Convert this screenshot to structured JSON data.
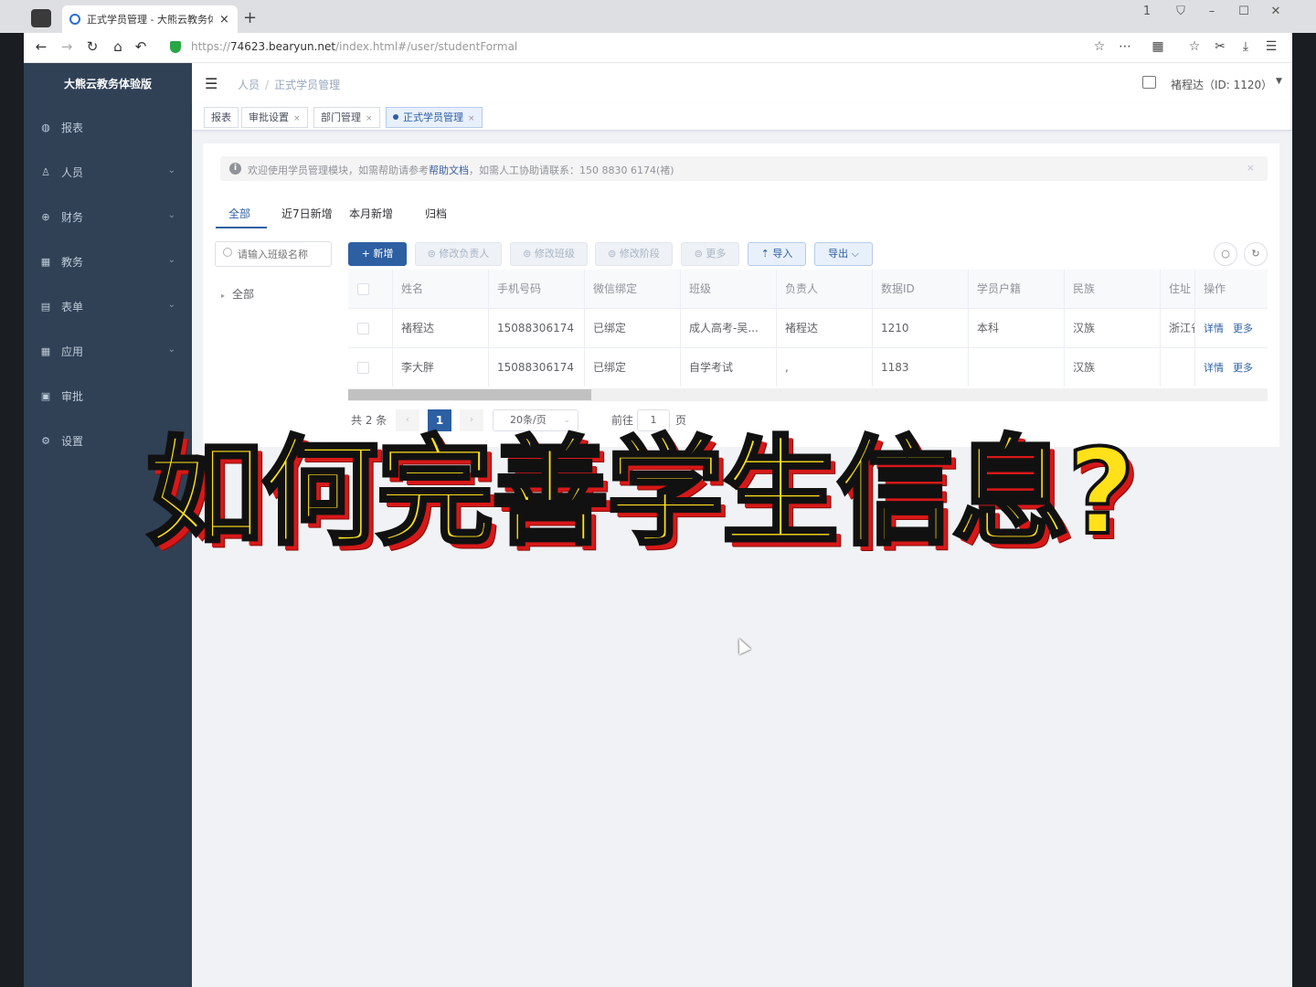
{
  "browser": {
    "tab_title": "正式学员管理 - 大熊云教务体验版",
    "tab_close": "×",
    "new_tab": "+",
    "url_scheme": "https://",
    "url_host": "74623.bearyun.net",
    "url_path": "/index.html#/user/studentFormal",
    "window_controls": [
      "1",
      "⛉",
      "–",
      "☐",
      "✕"
    ]
  },
  "app": {
    "brand": "大熊云教务体验版",
    "accent_color": "#2d5fa3",
    "sidebar_color": "#304156"
  },
  "sidebar": {
    "items": [
      {
        "label": "报表",
        "icon": "dashboard-icon",
        "glyph": "◍",
        "has_children": false
      },
      {
        "label": "人员",
        "icon": "user-icon",
        "glyph": "♙",
        "has_children": true
      },
      {
        "label": "财务",
        "icon": "finance-icon",
        "glyph": "⊕",
        "has_children": true
      },
      {
        "label": "教务",
        "icon": "grid-icon",
        "glyph": "▦",
        "has_children": true
      },
      {
        "label": "表单",
        "icon": "form-icon",
        "glyph": "▤",
        "has_children": true
      },
      {
        "label": "应用",
        "icon": "apps-icon",
        "glyph": "▦",
        "has_children": true
      },
      {
        "label": "审批",
        "icon": "approval-icon",
        "glyph": "▣",
        "has_children": false
      },
      {
        "label": "设置",
        "icon": "settings-icon",
        "glyph": "⚙",
        "has_children": false
      }
    ]
  },
  "navbar": {
    "breadcrumb": [
      "人员",
      "正式学员管理"
    ],
    "user": "褚程达（ID: 1120）"
  },
  "tags": [
    {
      "label": "报表",
      "closable": false,
      "active": false
    },
    {
      "label": "审批设置",
      "closable": true,
      "active": false
    },
    {
      "label": "部门管理",
      "closable": true,
      "active": false
    },
    {
      "label": "正式学员管理",
      "closable": true,
      "active": true
    }
  ],
  "alert": {
    "prefix": "欢迎使用学员管理模块，如需帮助请参考",
    "link": "帮助文档",
    "suffix": "，如需人工协助请联系：150 8830 6174(褚)",
    "close": "×"
  },
  "tabs": [
    "全部",
    "近7日新增",
    "本月新增",
    "归档"
  ],
  "tree": {
    "search_placeholder": "请输入班级名称",
    "root": "全部"
  },
  "toolbar": {
    "add": "+ 新增",
    "change_owner": "⊜ 修改负责人",
    "change_class": "⊜ 修改班级",
    "change_stage": "⊜ 修改阶段",
    "more": "⊜ 更多",
    "import": "⇡ 导入",
    "export": "导出 ⌵"
  },
  "table": {
    "headers": [
      "姓名",
      "手机号码",
      "微信绑定",
      "班级",
      "负责人",
      "数据ID",
      "学员户籍",
      "民族",
      "住址",
      "操作"
    ],
    "rows": [
      {
        "name": "褚程达",
        "phone": "15088306174",
        "wechat": "已绑定",
        "class": "成人高考-吴...",
        "owner": "褚程达",
        "id": "1210",
        "huji": "本科",
        "nation": "汉族",
        "address": "浙江省",
        "detail": "详情",
        "more": "更多"
      },
      {
        "name": "李大胖",
        "phone": "15088306174",
        "wechat": "已绑定",
        "class": "自学考试",
        "owner": ",",
        "id": "1183",
        "huji": "",
        "nation": "汉族",
        "address": "",
        "detail": "详情",
        "more": "更多"
      }
    ]
  },
  "pager": {
    "total": "共 2 条",
    "current": "1",
    "page_size": "20条/页",
    "goto_label": "前往",
    "goto_value": "1",
    "page_suffix": "页"
  },
  "overlay_caption": "如何完善学生信息?"
}
